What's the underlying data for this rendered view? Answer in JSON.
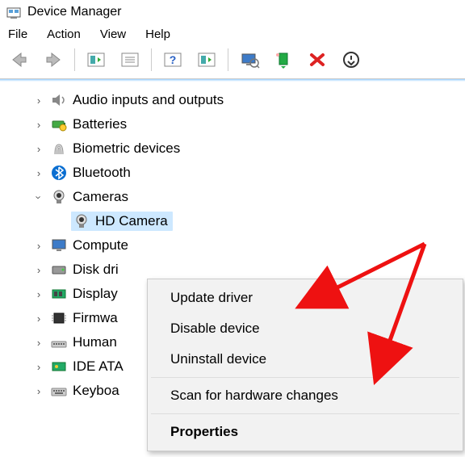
{
  "window": {
    "title": "Device Manager"
  },
  "menubar": {
    "items": [
      "File",
      "Action",
      "View",
      "Help"
    ]
  },
  "tree": {
    "nodes": [
      {
        "label": "Audio inputs and outputs",
        "expanded": false
      },
      {
        "label": "Batteries",
        "expanded": false
      },
      {
        "label": "Biometric devices",
        "expanded": false
      },
      {
        "label": "Bluetooth",
        "expanded": false
      },
      {
        "label": "Cameras",
        "expanded": true,
        "children": [
          {
            "label": "HD Camera",
            "selected": true
          }
        ]
      },
      {
        "label": "Compute",
        "expanded": false
      },
      {
        "label": "Disk dri",
        "expanded": false
      },
      {
        "label": "Display",
        "expanded": false
      },
      {
        "label": "Firmwa",
        "expanded": false
      },
      {
        "label": "Human",
        "expanded": false
      },
      {
        "label": "IDE ATA",
        "expanded": false
      },
      {
        "label": "Keyboa",
        "expanded": false
      }
    ]
  },
  "context_menu": {
    "items": [
      {
        "label": "Update driver"
      },
      {
        "label": "Disable device"
      },
      {
        "label": "Uninstall device"
      },
      {
        "divider": true
      },
      {
        "label": "Scan for hardware changes"
      },
      {
        "divider": true
      },
      {
        "label": "Properties",
        "bold": true
      }
    ]
  }
}
